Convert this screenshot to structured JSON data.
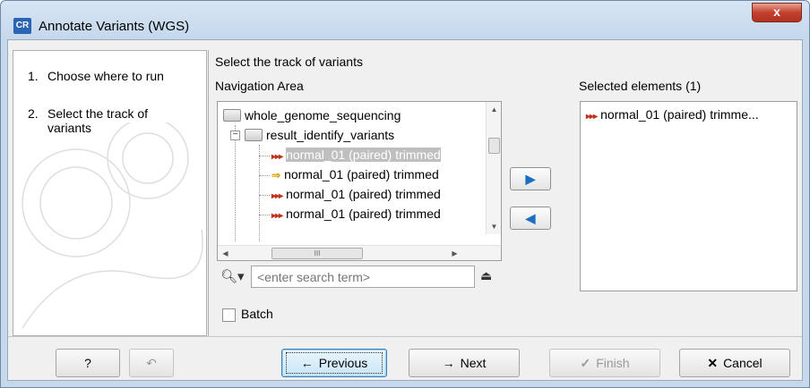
{
  "window": {
    "app_icon_text": "CR",
    "title": "Annotate Variants (WGS)",
    "close_glyph": "x",
    "accent_color": "#2b64b3"
  },
  "steps": [
    {
      "number": "1.",
      "label": "Choose where to run"
    },
    {
      "number": "2.",
      "label_line1": "Select the track of",
      "label_line2": "variants"
    }
  ],
  "main": {
    "heading": "Select the track of variants",
    "navigation_label": "Navigation Area",
    "selected_label": "Selected elements (1)",
    "tree": [
      {
        "label": "whole_genome_sequencing",
        "icon": "folder-icon"
      },
      {
        "label": "result_identify_variants",
        "icon": "folder-icon"
      },
      {
        "label": "normal_01 (paired) trimmed",
        "icon": "variant-track-icon",
        "selected": true
      },
      {
        "label": "normal_01 (paired) trimmed",
        "icon": "track-list-icon"
      },
      {
        "label": "normal_01 (paired) trimmed",
        "icon": "variant-track-icon"
      },
      {
        "label": "normal_01 (paired) trimmed",
        "icon": "variant-track-icon"
      }
    ],
    "hscroll_thumb_glyph": "III",
    "search_placeholder": "<enter search term>",
    "batch_label": "Batch",
    "batch_checked": false,
    "selected_items": [
      {
        "label": "normal_01 (paired) trimme...",
        "icon": "variant-track-icon"
      }
    ]
  },
  "buttons": {
    "help": "?",
    "previous": "Previous",
    "next": "Next",
    "finish": "Finish",
    "cancel": "Cancel"
  }
}
